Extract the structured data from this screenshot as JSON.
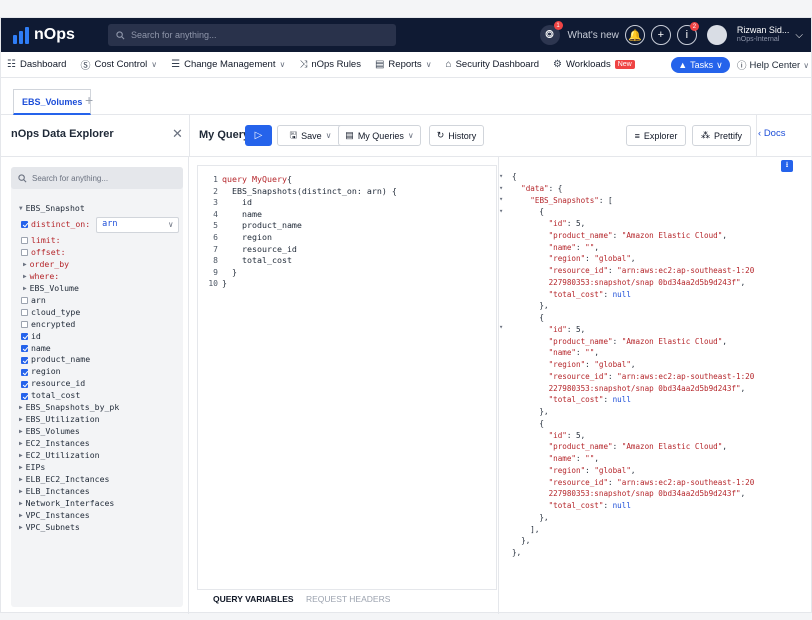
{
  "app": {
    "logo": "nOps",
    "search_placeholder": "Search for anything..."
  },
  "topbar": {
    "whats_new": "What's new",
    "notif_count": "1",
    "info_count": "2",
    "user_name": "Rizwan Sid...",
    "user_org": "nOps-Internal"
  },
  "nav": {
    "items": [
      {
        "label": "Dashboard",
        "icon": "grid-icon"
      },
      {
        "label": "Cost Control",
        "icon": "dollar-icon"
      },
      {
        "label": "Change Management",
        "icon": "list-icon"
      },
      {
        "label": "nOps Rules",
        "icon": "shuffle-icon"
      },
      {
        "label": "Reports",
        "icon": "report-icon"
      },
      {
        "label": "Security Dashboard",
        "icon": "lock-icon"
      },
      {
        "label": "Workloads",
        "icon": "gear-icon"
      }
    ],
    "new_badge": "New",
    "tasks": "Tasks",
    "help": "Help Center"
  },
  "tabs": [
    {
      "label": "EBS_Volumes"
    }
  ],
  "explorer": {
    "title": "nOps Data Explorer",
    "search_placeholder": "Search for anything...",
    "root": "EBS_Snapshot",
    "distinct_label": "distinct_on:",
    "distinct_value": "arn",
    "args": [
      "limit:",
      "offset:",
      "order_by",
      "where:"
    ],
    "sub": "EBS_Volume",
    "unchecked": [
      "arn",
      "cloud_type",
      "encrypted"
    ],
    "checked": [
      "id",
      "name",
      "product_name",
      "region",
      "resource_id",
      "total_cost"
    ],
    "others": [
      "EBS_Snapshots_by_pk",
      "EBS_Utilization",
      "EBS_Volumes",
      "EC2_Instances",
      "EC2_Utilization",
      "EIPs",
      "ELB_EC2_Inctances",
      "ELB_Inctances",
      "Network_Interfaces",
      "VPC_Instances",
      "VPC_Subnets"
    ]
  },
  "toolbar": {
    "my_query": "My Query",
    "save": "Save",
    "my_queries": "My Queries",
    "history": "History",
    "explorer": "Explorer",
    "prettify": "Prettify",
    "docs": "Docs"
  },
  "editor": {
    "line_numbers": [
      "1",
      "2",
      "3",
      "4",
      "5",
      "6",
      "7",
      "8",
      "9",
      "10"
    ],
    "query_keyword": "query",
    "query_name": "MyQuery",
    "call": "EBS_Snapshots(distinct_on: arn) {",
    "fields": [
      "id",
      "name",
      "product_name",
      "region",
      "resource_id",
      "total_cost"
    ],
    "query_variables": "QUERY VARIABLES",
    "request_headers": "REQUEST HEADERS"
  },
  "result": {
    "root_key": "\"data\"",
    "list_key": "\"EBS_Snapshots\"",
    "records": [
      {
        "id": "5",
        "product_name": "\"Amazon Elastic Cloud\"",
        "name": "\"\"",
        "region": "\"global\"",
        "resource_id_1": "\"arn:aws:ec2:ap-southeast-1:20",
        "resource_id_2": "227980353:snapshot/snap 0bd34aa2d5b9d243f\"",
        "total_cost": "null"
      },
      {
        "id": "5",
        "product_name": "\"Amazon Elastic Cloud\"",
        "name": "\"\"",
        "region": "\"global\"",
        "resource_id_1": "\"arn:aws:ec2:ap-southeast-1:20",
        "resource_id_2": "227980353:snapshot/snap 0bd34aa2d5b9d243f\"",
        "total_cost": "null"
      },
      {
        "id": "5",
        "product_name": "\"Amazon Elastic Cloud\"",
        "name": "\"\"",
        "region": "\"global\"",
        "resource_id_1": "\"arn:aws:ec2:ap-southeast-1:20",
        "resource_id_2": "227980353:snapshot/snap 0bd34aa2d5b9d243f\"",
        "total_cost": "null"
      }
    ]
  },
  "colors": {
    "brand": "#2563eb",
    "topbar": "#0f1a33",
    "code_red": "#b5262b"
  }
}
